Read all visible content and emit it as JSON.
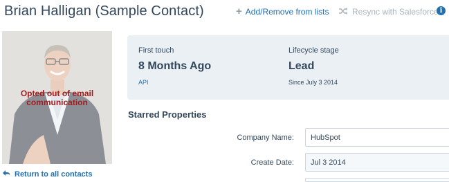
{
  "header": {
    "contact_name": "Brian Halligan (Sample Contact)",
    "add_remove_label": "Add/Remove from lists",
    "resync_label": "Resync with Salesforce",
    "info_icon": "i"
  },
  "sidebar": {
    "opt_out_text": "Opted out of email communication",
    "return_label": "Return to all contacts"
  },
  "summary": {
    "first_touch": {
      "label": "First touch",
      "value": "8 Months Ago",
      "sub": "API"
    },
    "lifecycle": {
      "label": "Lifecycle stage",
      "value": "Lead",
      "sub": "Since July 3 2014"
    }
  },
  "starred": {
    "title": "Starred Properties",
    "properties": [
      {
        "label": "Company Name:",
        "value": "HubSpot"
      },
      {
        "label": "Create Date:",
        "value": "Jul 3 2014"
      }
    ]
  },
  "colors": {
    "accent": "#1f6fb2",
    "text": "#33475b",
    "warning": "#a11d1d",
    "card_bg": "#eaf0f4"
  }
}
